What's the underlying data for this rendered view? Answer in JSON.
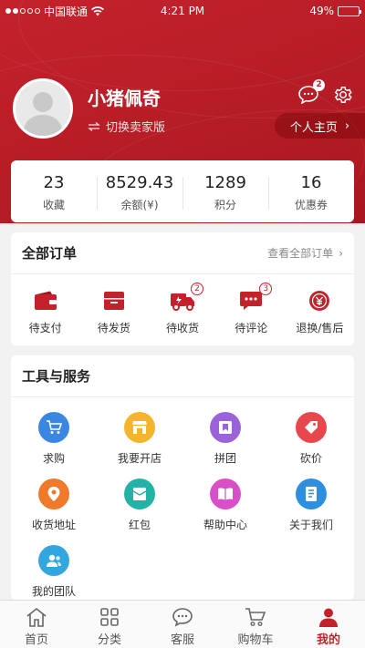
{
  "status_bar": {
    "carrier": "中国联通",
    "time": "4:21 PM",
    "battery": "49%",
    "battery_level": 0.49
  },
  "profile": {
    "username": "小猪佩奇",
    "switch_label": "切换卖家版",
    "homepage_label": "个人主页",
    "message_badge": "2"
  },
  "stats": [
    {
      "value": "23",
      "label": "收藏"
    },
    {
      "value": "8529.43",
      "label": "余额(¥)"
    },
    {
      "value": "1289",
      "label": "积分"
    },
    {
      "value": "16",
      "label": "优惠券"
    }
  ],
  "orders": {
    "title": "全部订单",
    "view_all": "查看全部订单",
    "items": [
      {
        "label": "待支付",
        "icon": "wallet-icon",
        "badge": ""
      },
      {
        "label": "待发货",
        "icon": "package-icon",
        "badge": ""
      },
      {
        "label": "待收货",
        "icon": "truck-icon",
        "badge": "2"
      },
      {
        "label": "待评论",
        "icon": "comment-icon",
        "badge": "3"
      },
      {
        "label": "退换/售后",
        "icon": "refund-icon",
        "badge": ""
      }
    ]
  },
  "tools": {
    "title": "工具与服务",
    "items": [
      {
        "label": "求购",
        "icon": "cart-icon",
        "color": "#3a86e0"
      },
      {
        "label": "我要开店",
        "icon": "store-icon",
        "color": "#f3b52b"
      },
      {
        "label": "拼团",
        "icon": "group-buy-icon",
        "color": "#9a63d9"
      },
      {
        "label": "砍价",
        "icon": "tag-icon",
        "color": "#e8474d"
      },
      {
        "label": "收货地址",
        "icon": "location-icon",
        "color": "#f07a2c"
      },
      {
        "label": "红包",
        "icon": "red-envelope-icon",
        "color": "#22b3a6"
      },
      {
        "label": "帮助中心",
        "icon": "book-icon",
        "color": "#d94fc8"
      },
      {
        "label": "关于我们",
        "icon": "document-icon",
        "color": "#2d8fe0"
      },
      {
        "label": "我的团队",
        "icon": "team-icon",
        "color": "#33a6e0"
      }
    ]
  },
  "tabbar": [
    {
      "label": "首页",
      "icon": "home-icon",
      "active": false
    },
    {
      "label": "分类",
      "icon": "grid-icon",
      "active": false
    },
    {
      "label": "客服",
      "icon": "chat-icon",
      "active": false
    },
    {
      "label": "购物车",
      "icon": "cart-icon",
      "active": false
    },
    {
      "label": "我的",
      "icon": "user-icon",
      "active": true
    }
  ],
  "colors": {
    "brand": "#c4222b",
    "background": "#f2f2f2"
  }
}
